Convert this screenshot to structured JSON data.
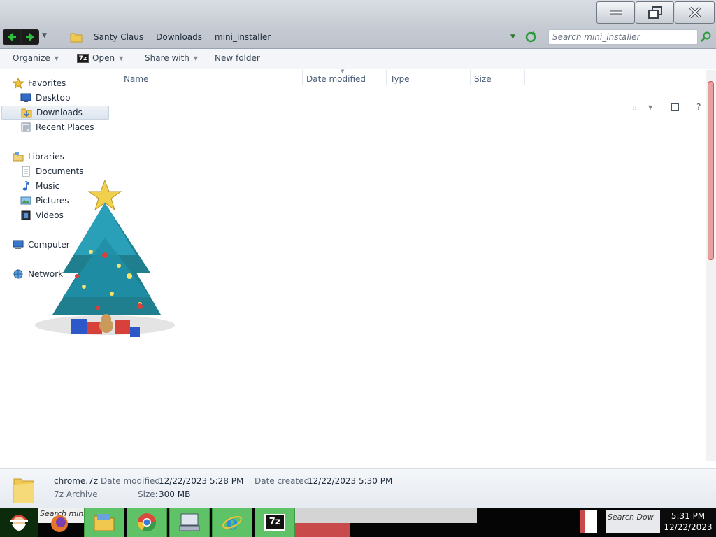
{
  "window": {
    "breadcrumbs": [
      "Santy Claus",
      "Downloads",
      "mini_installer"
    ],
    "search_placeholder": "Search mini_installer"
  },
  "toolbar": {
    "organize": "Organize",
    "open": "Open",
    "open_badge": "7z",
    "share_with": "Share with",
    "new_folder": "New folder"
  },
  "nav": {
    "favorites": "Favorites",
    "desktop": "Desktop",
    "downloads": "Downloads",
    "recent_places": "Recent Places",
    "libraries": "Libraries",
    "documents": "Documents",
    "music": "Music",
    "pictures": "Pictures",
    "videos": "Videos",
    "computer": "Computer",
    "network": "Network"
  },
  "columns": [
    "Name",
    "Date modified",
    "Type",
    "Size"
  ],
  "details": {
    "file_name": "chrome.7z",
    "file_type": "7z Archive",
    "date_modified_label": "Date modified:",
    "date_modified": "12/22/2023 5:28 PM",
    "date_created_label": "Date created:",
    "date_created": "12/22/2023 5:30 PM",
    "size_label": "Size:",
    "size": "300 MB"
  },
  "taskbar": {
    "search_text": "Search mini",
    "tray_search_text": "Search Dow",
    "time": "5:31 PM",
    "date": "12/22/2023",
    "sevenz_label": "7z"
  },
  "colors": {
    "taskbar_green": "#5fc266",
    "accent_red": "#c94a4a"
  }
}
